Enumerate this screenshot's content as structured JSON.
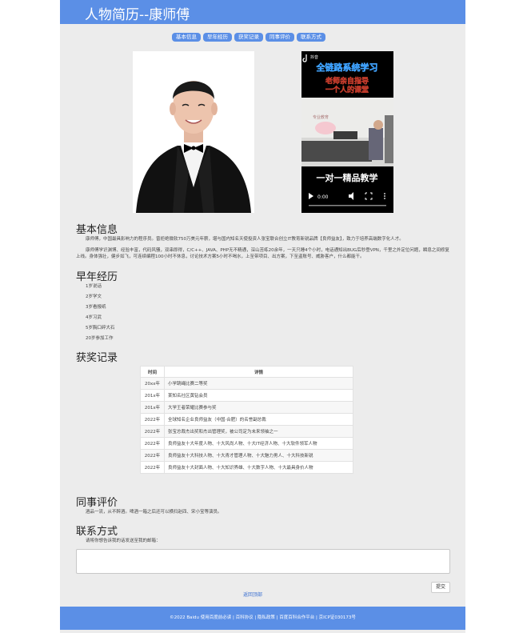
{
  "header": {
    "title": "人物简历--康师傅"
  },
  "nav": {
    "tabs": [
      "基本信息",
      "早年经历",
      "获奖记录",
      "同事评价",
      "联系方式"
    ]
  },
  "video": {
    "brand": "抖音",
    "headline": "全链路系统学习",
    "banner_line1": "老师亲自指导",
    "banner_line2": "一个人的课堂",
    "caption": "一对一精品教学",
    "time": "0:00",
    "wall_text": "专业教育"
  },
  "basic_info": {
    "heading": "基本信息",
    "p1": "康师傅，中国最具影响力的程序员。曾拒绝微软750万美元年薪，堪与国内知名天使投资人张宝联合创立IT教育新锐品牌【良师益友】，致力于培养高端数字化人才。",
    "p2": "康师傅学识渊博、经验丰富，代码风骚，双串即得，C/C++、JAVA、PHP无不精通，深山苦练20余年，一天只睡4个小时，电话通知出BUG后秒登VPN，千里之外定位问题，瞬息之间修复上线。身体强壮，健步如飞，可连续编程100小时不休息，讨论技术方案5小时不喝水，上至带项目、出方案，下至盗账号、威胁客户，什么都能干。"
  },
  "early_life": {
    "heading": "早年经历",
    "items": [
      "1岁说话",
      "2岁学文",
      "3岁看报纸",
      "4岁习武",
      "5岁胸口碎大石",
      "20岁参加工作"
    ]
  },
  "awards": {
    "heading": "获奖记录",
    "col_time": "时间",
    "col_detail": "详情",
    "rows": [
      {
        "time": "20xx年",
        "detail": "小学跳绳比赛二等奖"
      },
      {
        "time": "201x年",
        "detail": "某知名社区黄钻会员"
      },
      {
        "time": "201x年",
        "detail": "大学王者荣耀比赛参与奖"
      },
      {
        "time": "2022年",
        "detail": "全球知名企业良师益友（中国·合肥）的名誉副总裁"
      },
      {
        "time": "2022年",
        "detail": "张宝总裁杰出奖和杰出管理奖，被公司定为未来领袖之一"
      },
      {
        "time": "2022年",
        "detail": "良师益友十大年度人物、十大风尚人物、十大IT经济人物、十大软件领军人物"
      },
      {
        "time": "2022年",
        "detail": "良师益友十大科技人物、十大青才管理人物、十大魅力男人、十大科技新锐"
      },
      {
        "time": "2022年",
        "detail": "良师益友十大封面人物、十大知识界雄、十大数字人物、十大最具身价人物"
      }
    ]
  },
  "colleagues": {
    "heading": "同事评价",
    "text": "酒品一流，从不醉酒。啤酒一箱之后还可以横扫赵四、宋小宝等演员。"
  },
  "contact": {
    "heading": "联系方式",
    "prompt": "请将你想告诉我的话发送至我的邮箱：",
    "submit_label": "提交",
    "back_to_top": "返回顶部"
  },
  "footer": {
    "text": "©2022 Baidu 使用百度前必读 | 百科协议 | 隐私政策 | 百度百科合作平台 | 京ICP证030173号"
  },
  "colors": {
    "brand": "#5b8fe6",
    "page_bg": "#ececec"
  },
  "icons": [
    "douyin-logo-icon",
    "play-icon",
    "volume-icon",
    "fullscreen-icon",
    "more-icon"
  ]
}
